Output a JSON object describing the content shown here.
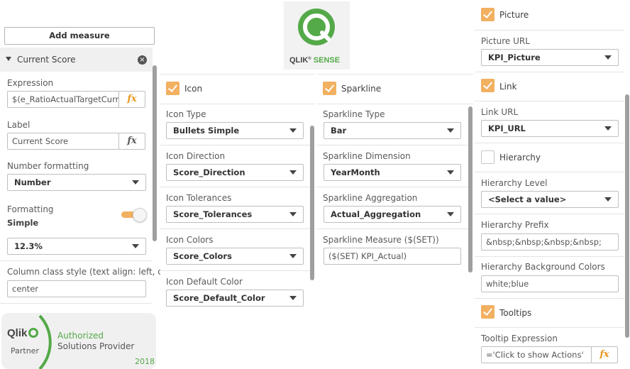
{
  "left": {
    "add_measure_label": "Add measure",
    "measure_title": "Current Score",
    "expression_label": "Expression",
    "expression_value": "$(e_RatioActualTargetCurren",
    "fx_symbol": "fx",
    "label_label": "Label",
    "label_value": "Current Score",
    "number_formatting_label": "Number formatting",
    "number_formatting_value": "Number",
    "formatting_label": "Formatting",
    "formatting_mode": "Simple",
    "formatting_value": "12.3%",
    "column_class_label": "Column class style (text align: left, ce...",
    "column_class_value": "center"
  },
  "partner": {
    "brand": "Qlik",
    "partner_label": "Partner",
    "line1": "Authorized",
    "line2": "Solutions Provider",
    "year": "2018"
  },
  "logo": {
    "text": "QLIK",
    "reg": "®",
    "sense": "SENSE"
  },
  "icon_panel": {
    "header": "Icon",
    "fields": [
      {
        "label": "Icon Type",
        "value": "Bullets Simple"
      },
      {
        "label": "Icon Direction",
        "value": "Score_Direction"
      },
      {
        "label": "Icon Tolerances",
        "value": "Score_Tolerances"
      },
      {
        "label": "Icon Colors",
        "value": "Score_Colors"
      },
      {
        "label": "Icon Default Color",
        "value": "Score_Default_Color"
      }
    ]
  },
  "sparkline_panel": {
    "header": "Sparkline",
    "fields": [
      {
        "label": "Sparkline Type",
        "value": "Bar"
      },
      {
        "label": "Sparkline Dimension",
        "value": "YearMonth"
      },
      {
        "label": "Sparkline Aggregation",
        "value": "Actual_Aggregation"
      },
      {
        "label": "Sparkline Measure ($(SET))",
        "value": "($(SET) KPI_Actual)"
      }
    ]
  },
  "right": {
    "picture_label": "Picture",
    "picture_url_label": "Picture URL",
    "picture_url_value": "KPI_Picture",
    "link_label": "Link",
    "link_url_label": "Link URL",
    "link_url_value": "KPI_URL",
    "hierarchy_label": "Hierarchy",
    "hierarchy_level_label": "Hierarchy Level",
    "hierarchy_level_value": "<Select a value>",
    "hierarchy_prefix_label": "Hierarchy Prefix",
    "hierarchy_prefix_value": "&nbsp;&nbsp;&nbsp;&nbsp;",
    "hierarchy_bg_label": "Hierarchy Background Colors",
    "hierarchy_bg_value": "white;blue",
    "tooltips_label": "Tooltips",
    "tooltip_expr_label": "Tooltip Expression",
    "tooltip_expr_value": "='Click to show Actions'",
    "fx_symbol": "fx"
  },
  "colors": {
    "qlik_green": "#54a948",
    "checkbox_orange": "#f2b061",
    "fx_orange": "#e8961f",
    "toggle_orange": "#f2b061"
  }
}
